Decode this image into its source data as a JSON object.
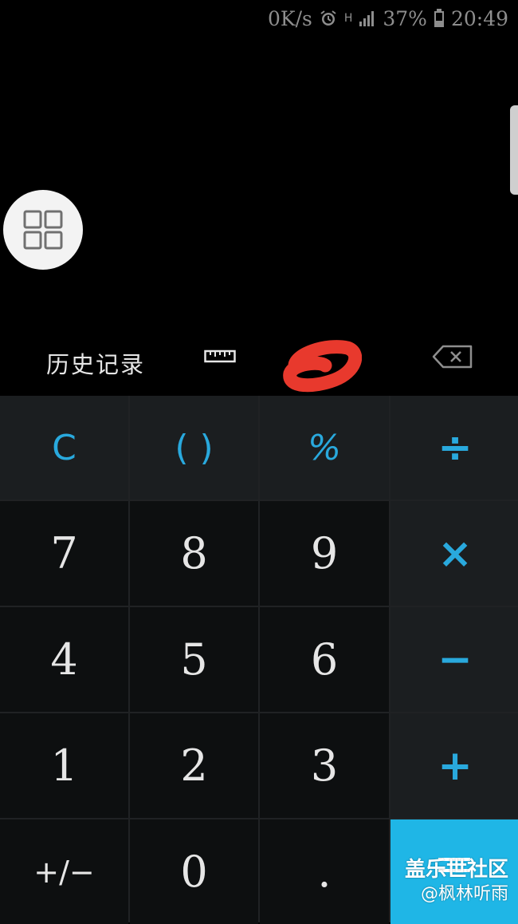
{
  "status_bar": {
    "net_speed": "0K/s",
    "alarm_icon": "alarm-clock-icon",
    "network_type": "H",
    "signal_icon": "signal-bars-icon",
    "battery_percent": "37%",
    "battery_icon": "battery-icon",
    "time": "20:49"
  },
  "toolbar": {
    "history_label": "历史记录",
    "ruler_icon": "ruler-icon",
    "backspace_icon": "backspace-icon",
    "annotation_color": "#e8392d"
  },
  "keypad": {
    "row1": [
      "C",
      "( )",
      "%",
      "÷"
    ],
    "row2": [
      "7",
      "8",
      "9",
      "×"
    ],
    "row3": [
      "4",
      "5",
      "6",
      "−"
    ],
    "row4": [
      "1",
      "2",
      "3",
      "+"
    ],
    "row5": [
      "+/−",
      "0",
      ".",
      "="
    ]
  },
  "watermark": {
    "line1": "盖乐世社区",
    "line2": "@枫林听雨"
  },
  "colors": {
    "accent": "#29a9dd",
    "equals_bg": "#1fb6e6",
    "function_key_bg": "#1b1e20",
    "digit_key_bg": "#0d0f10"
  }
}
